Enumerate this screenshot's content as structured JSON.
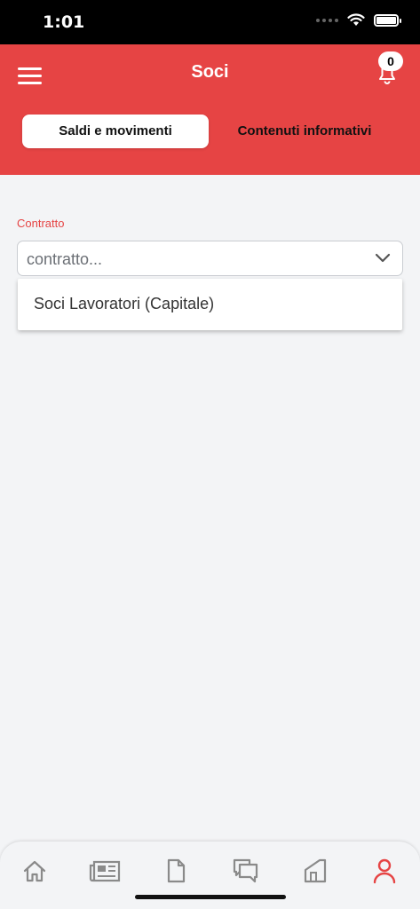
{
  "status_bar": {
    "time": "1:01"
  },
  "header": {
    "title": "Soci",
    "notification_count": "0",
    "tabs": [
      {
        "label": "Saldi e movimenti",
        "active": true
      },
      {
        "label": "Contenuti informativi",
        "active": false
      }
    ]
  },
  "form": {
    "contract_label": "Contratto",
    "contract_placeholder": "contratto...",
    "dropdown_options": [
      "Soci Lavoratori (Capitale)"
    ]
  },
  "bottom_nav": {
    "items": [
      {
        "icon": "home-icon"
      },
      {
        "icon": "newspaper-icon"
      },
      {
        "icon": "document-icon"
      },
      {
        "icon": "chat-icon"
      },
      {
        "icon": "house-door-icon"
      },
      {
        "icon": "user-icon",
        "active": true
      }
    ]
  },
  "colors": {
    "accent": "#e64444",
    "background": "#f3f4f6",
    "nav_icon": "#8a8a8a"
  }
}
